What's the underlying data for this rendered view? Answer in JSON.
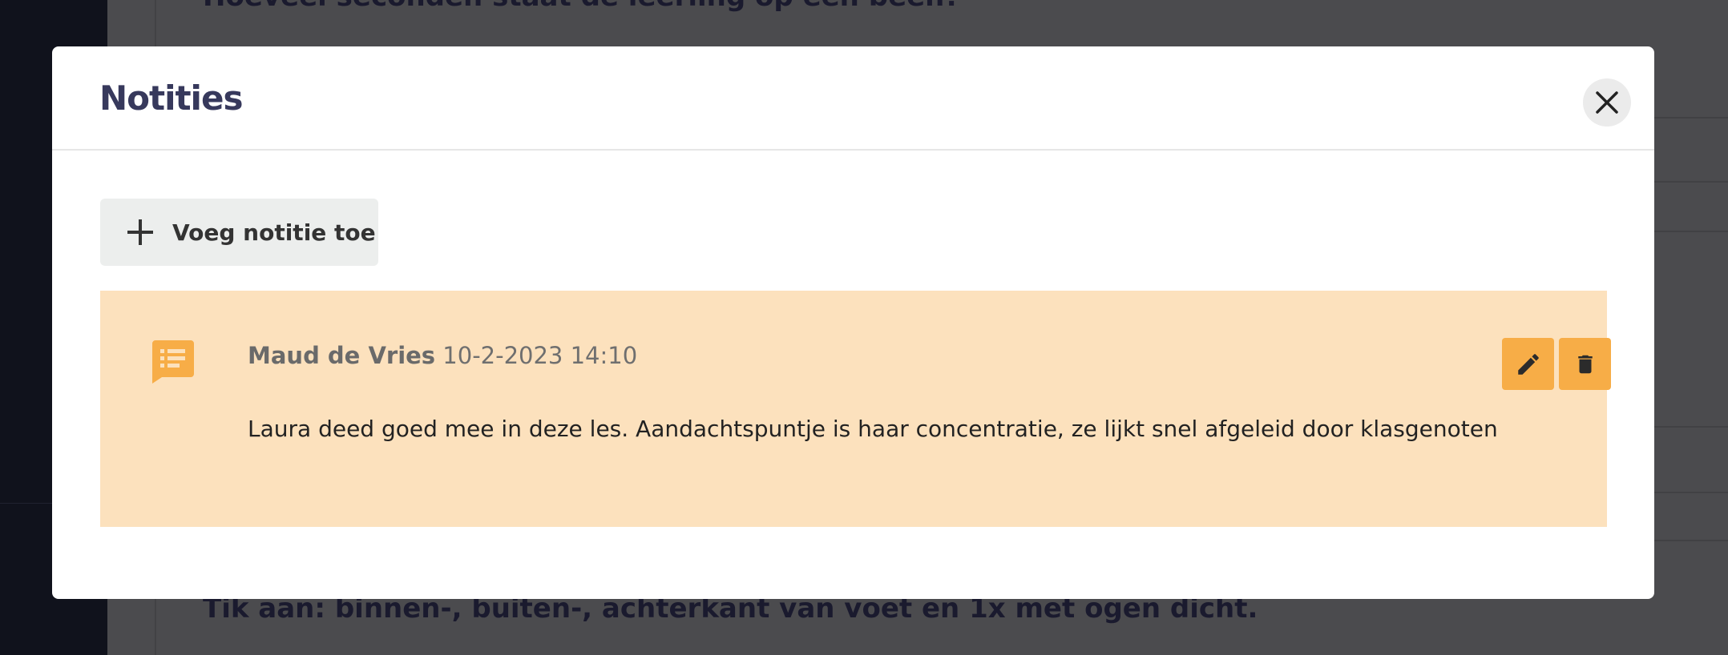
{
  "background": {
    "top_text": "Hoeveel seconden staat de leerling op een been?",
    "bottom_text": "Tik aan: binnen-, buiten-, achterkant van voet en 1x met ogen dicht."
  },
  "modal": {
    "title": "Notities",
    "add_button_label": "Voeg notitie toe",
    "notes": [
      {
        "author": "Maud de Vries",
        "datetime": "10-2-2023 14:10",
        "text": "Laura deed goed mee in deze les. Aandachtspuntje is haar concentratie, ze lijkt snel afgeleid door klasgenoten"
      }
    ]
  },
  "icons": {
    "close": "close-icon",
    "add": "plus-icon",
    "note": "note-icon",
    "edit": "pencil-icon",
    "delete": "trash-icon"
  },
  "colors": {
    "title": "#37395c",
    "note_background": "#fce1bd",
    "accent": "#f7ad47",
    "add_button_bg": "#eceeed",
    "overlay": "#4b4b4e"
  }
}
